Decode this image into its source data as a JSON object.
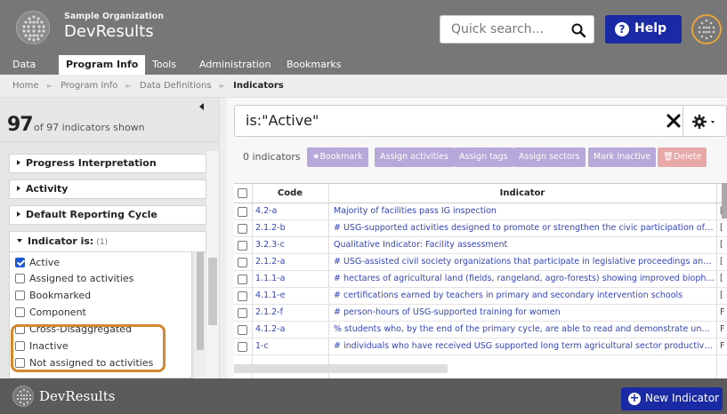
{
  "header": {
    "org_name": "Sample Organization",
    "app_name": "DevResults",
    "quick_search_placeholder": "Quick search...",
    "help_label": "Help",
    "help_icon_glyph": "?",
    "accent_color": "#1a2aa5"
  },
  "nav": {
    "tabs": [
      {
        "label": "Data"
      },
      {
        "label": "Program Info",
        "active": true
      },
      {
        "label": "Tools"
      },
      {
        "label": "Administration"
      },
      {
        "label": "Bookmarks"
      }
    ]
  },
  "breadcrumb": {
    "items": [
      "Home",
      "Program Info",
      "Data Definitions",
      "Indicators"
    ],
    "separator": "►"
  },
  "sidebar": {
    "count": "97",
    "count_suffix": "of 97 indicators shown",
    "sections": [
      {
        "label": "Progress Interpretation"
      },
      {
        "label": "Activity"
      },
      {
        "label": "Default Reporting Cycle"
      }
    ],
    "indicator_is": {
      "label": "Indicator is:",
      "count": "(1)",
      "options": [
        {
          "label": "Active",
          "checked": true
        },
        {
          "label": "Assigned to activities",
          "checked": false
        },
        {
          "label": "Bookmarked",
          "checked": false
        },
        {
          "label": "Component",
          "checked": false
        },
        {
          "label": "Cross-Disaggregated",
          "checked": false
        },
        {
          "label": "Inactive",
          "checked": false
        },
        {
          "label": "Not assigned to activities",
          "checked": false
        }
      ]
    },
    "highlight_color": "#d6882e"
  },
  "main": {
    "search_value": "is:\"Active\"",
    "count_label": "0 indicators",
    "toolbar_buttons": [
      {
        "label": "★Bookmark"
      },
      {
        "label": "Assign activities"
      },
      {
        "label": "Assign tags"
      },
      {
        "label": "Assign sectors"
      },
      {
        "label": "Mark Inactive"
      },
      {
        "label": "🗑Delete"
      }
    ],
    "table": {
      "columns": [
        "Code",
        "Indicator"
      ],
      "rows": [
        {
          "code": "4.2-a",
          "indicator": "Majority of facilities pass IG inspection",
          "extra": "[",
          "extra_suffix": ""
        },
        {
          "code": "2.1.2-b",
          "indicator": "# USG-supported activities designed to promote or strengthen the civic participation of women",
          "extra": "[",
          "extra_suffix": ""
        },
        {
          "code": "3.2.3-c",
          "indicator": "Qualitative Indicator: Facility assessment",
          "extra": "[",
          "extra_suffix": ""
        },
        {
          "code": "2.1.2-a",
          "indicator": "# USG-assisted civil society organizations that participate in legislative proceedings and/or en...",
          "extra": "[",
          "extra_suffix": ""
        },
        {
          "code": "1.1.1-a",
          "indicator": "# hectares of agricultural land (fields, rangeland, agro-forests) showing improved biophysical ...",
          "extra": "[",
          "extra_suffix": ""
        },
        {
          "code": "4.1.1-e",
          "indicator": "# certifications earned by teachers in primary and secondary intervention schools",
          "extra": "[",
          "extra_suffix": ""
        },
        {
          "code": "2.1.2-f",
          "indicator": "# person-hours of USG-supported training for women",
          "extra": "F",
          "extra_suffix": ""
        },
        {
          "code": "4.1.2-a",
          "indicator": "% students who, by the end of the primary cycle, are able to read and demonstrate understan...",
          "extra": "F",
          "extra_suffix": ""
        },
        {
          "code": "1-c",
          "indicator": "# individuals who have received USG supported long term agricultural sector productivity or f...",
          "extra": "F",
          "extra_suffix": ""
        }
      ]
    }
  },
  "footer": {
    "app_name": "DevResults",
    "new_indicator_label": "New Indicator",
    "plus_glyph": "+"
  }
}
